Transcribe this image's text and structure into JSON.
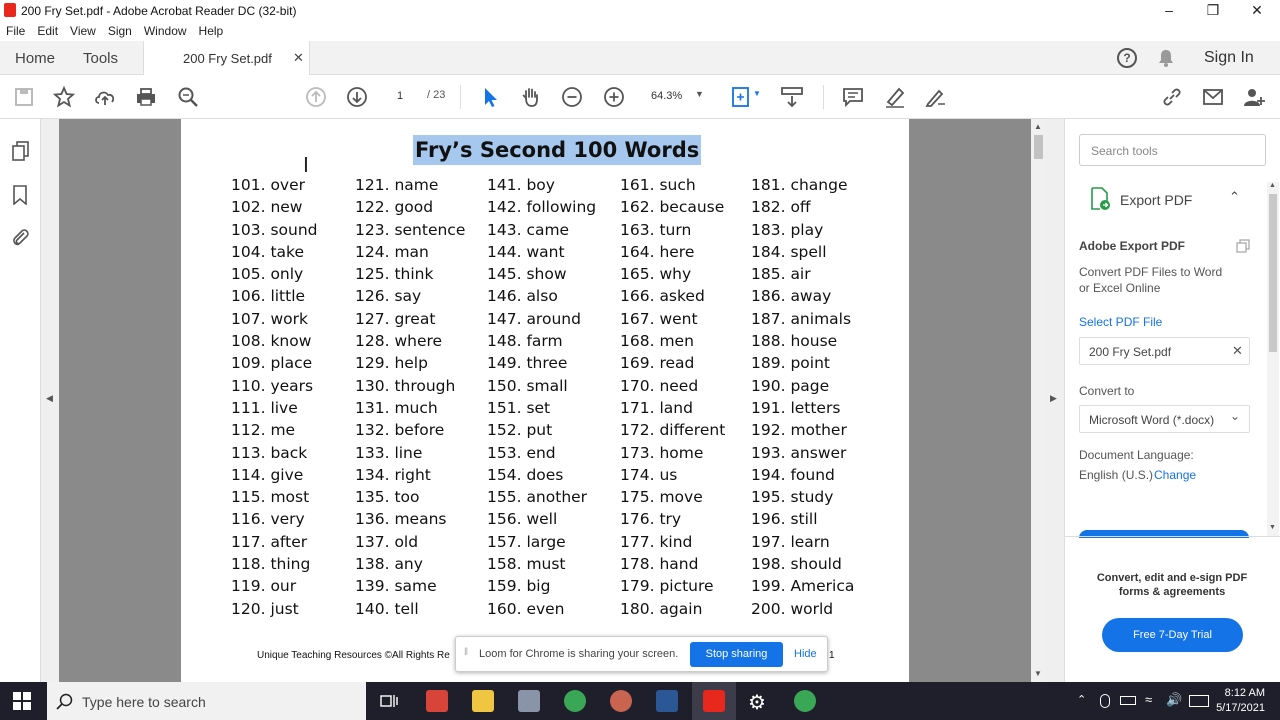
{
  "window": {
    "title": "200 Fry Set.pdf - Adobe Acrobat Reader DC (32-bit)"
  },
  "menu": [
    "File",
    "Edit",
    "View",
    "Sign",
    "Window",
    "Help"
  ],
  "tabs": {
    "home": "Home",
    "tools": "Tools",
    "document": "200 Fry Set.pdf"
  },
  "header_right": {
    "sign_in": "Sign In"
  },
  "toolbar": {
    "page_current": "1",
    "page_total": "/ 23",
    "zoom": "64.3%"
  },
  "document": {
    "title": "Fry’s Second 100 Words",
    "columns": [
      [
        "101. over",
        "102. new",
        "103. sound",
        "104. take",
        "105. only",
        "106. little",
        "107. work",
        "108. know",
        "109. place",
        "110. years",
        "111. live",
        "112. me",
        "113. back",
        "114. give",
        "115. most",
        "116. very",
        "117. after",
        "118. thing",
        "119. our",
        "120. just"
      ],
      [
        "121. name",
        "122. good",
        "123. sentence",
        "124. man",
        "125. think",
        "126. say",
        "127. great",
        "128. where",
        "129. help",
        "130. through",
        "131. much",
        "132. before",
        "133. line",
        "134. right",
        "135. too",
        "136. means",
        "137. old",
        "138. any",
        "139. same",
        "140. tell"
      ],
      [
        "141. boy",
        "142. following",
        "143. came",
        "144. want",
        "145. show",
        "146. also",
        "147. around",
        "148. farm",
        "149. three",
        "150. small",
        "151. set",
        "152. put",
        "153. end",
        "154. does",
        "155. another",
        "156. well",
        "157. large",
        "158. must",
        "159. big",
        "160. even"
      ],
      [
        "161. such",
        "162. because",
        "163. turn",
        "164. here",
        "165. why",
        "166. asked",
        "167. went",
        "168. men",
        "169. read",
        "170. need",
        "171. land",
        "172. different",
        "173. home",
        "174. us",
        "175. move",
        "176. try",
        "177. kind",
        "178. hand",
        "179. picture",
        "180. again"
      ],
      [
        "181. change",
        "182. off",
        "183. play",
        "184. spell",
        "185. air",
        "186. away",
        "187. animals",
        "188. house",
        "189. point",
        "190. page",
        "191. letters",
        "192. mother",
        "193. answer",
        "194. found",
        "195. study",
        "196. still",
        "197. learn",
        "198. should",
        "199. America",
        "200. world"
      ]
    ],
    "footer": "Unique Teaching Resources ©All Rights Re",
    "footer_page": "1"
  },
  "right_panel": {
    "search_placeholder": "Search tools",
    "export_label": "Export PDF",
    "adobe_export_title": "Adobe Export PDF",
    "adobe_export_desc_1": "Convert PDF Files to Word",
    "adobe_export_desc_2": "or Excel Online",
    "select_file": "Select PDF File",
    "file_name": "200 Fry Set.pdf",
    "convert_to_label": "Convert to",
    "convert_to_value": "Microsoft Word (*.docx)",
    "doc_language_label": "Document Language:",
    "doc_language_value": "English (U.S.)",
    "change_link": "Change",
    "promo_1": "Convert, edit and e-sign PDF",
    "promo_2": "forms & agreements",
    "trial_button": "Free 7-Day Trial"
  },
  "loom": {
    "message": "Loom for Chrome is sharing your screen.",
    "stop": "Stop sharing",
    "hide": "Hide"
  },
  "taskbar": {
    "search_placeholder": "Type here to search",
    "time": "8:12 AM",
    "date": "5/17/2021"
  },
  "colors": {
    "accent_blue": "#1473e6",
    "title_highlight": "#a6c8ee",
    "taskbar": "#1f1f2b"
  }
}
